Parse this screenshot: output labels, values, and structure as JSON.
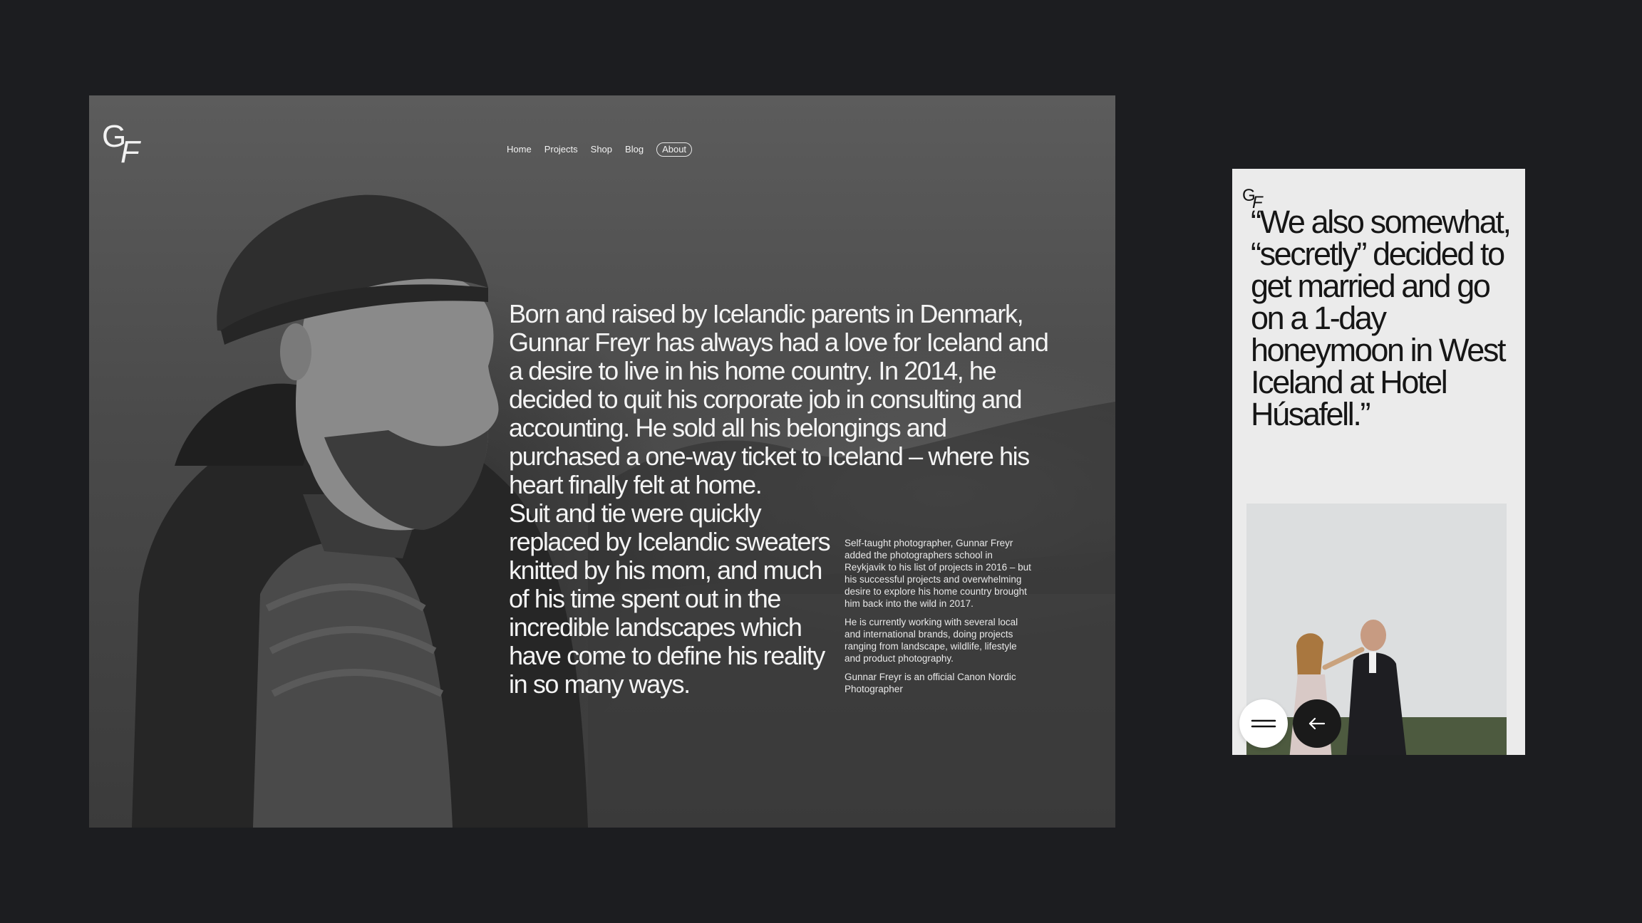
{
  "desktop": {
    "logo": {
      "first": "G",
      "second": "F"
    },
    "nav": [
      {
        "label": "Home",
        "active": false
      },
      {
        "label": "Projects",
        "active": false
      },
      {
        "label": "Shop",
        "active": false
      },
      {
        "label": "Blog",
        "active": false
      },
      {
        "label": "About",
        "active": true
      }
    ],
    "bio_main": "Born and raised by Icelandic parents in Denmark, Gunnar Freyr has always had a love for Iceland and a desire to live in his home country. In 2014, he decided to quit his corporate job in consulting and accounting. He sold all his belongings and purchased a one-way ticket to Iceland – where his heart finally felt at home.",
    "bio_continued": "Suit and tie were quickly replaced by Icelandic sweaters knitted by his mom, and much of his time spent out in the incredible landscapes which have come to define his reality in so many ways.",
    "bio_side": [
      "Self-taught photographer, Gunnar Freyr added the photographers school in Reykjavik to his list of projects in 2016 – but his successful projects and overwhelming desire to explore his home country brought him back into the wild in 2017.",
      "He is currently working with several local and international brands, doing projects ranging from landscape, wildlife, lifestyle and product photography.",
      "Gunnar Freyr is an official Canon Nordic Photographer"
    ]
  },
  "mobile": {
    "logo": {
      "first": "G",
      "second": "F"
    },
    "quote": "“We also somewhat, “secretly” decided to get married and go on a 1-day honeymoon in West Iceland at Hotel Húsafell.”",
    "buttons": {
      "menu_icon": "hamburger-icon",
      "back_icon": "arrow-left-icon"
    }
  },
  "colors": {
    "background": "#1c1d20",
    "mobile_bg": "#ebebeb",
    "text_light": "#f4f4f4",
    "text_dark": "#161616"
  }
}
